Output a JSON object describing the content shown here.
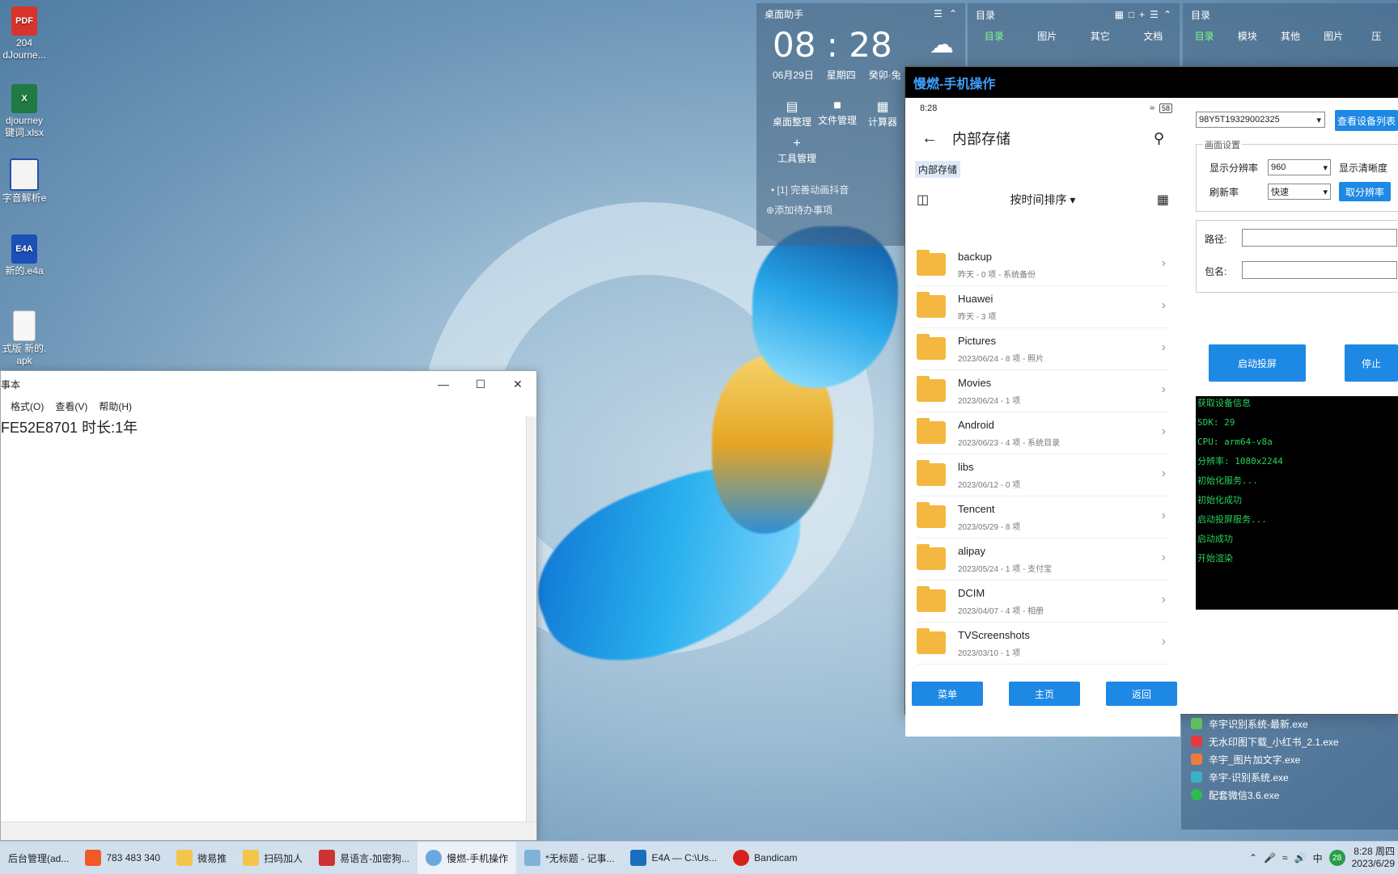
{
  "desktop": {
    "icons": [
      {
        "badge": "PDF",
        "line1": "204",
        "line2": "dJourne..."
      },
      {
        "badge": "X",
        "line1": "djourney",
        "line2": "键词.xlsx"
      },
      {
        "badge": "",
        "line1": "字音解析e",
        "line2": ""
      },
      {
        "badge": "E4A",
        "line1": "新的.e4a",
        "line2": ""
      },
      {
        "badge": "",
        "line1": "式版 新的.",
        "line2": "apk"
      }
    ]
  },
  "notepad": {
    "title": "事本",
    "menu": [
      "格式(O)",
      "查看(V)",
      "帮助(H)"
    ],
    "content": "FE52E8701  时长:1年"
  },
  "widget": {
    "title": "桌面助手",
    "time": "08 : 28",
    "date": "06月29日",
    "weekday": "星期四",
    "lunar": "癸卯·兔",
    "tools": [
      "桌面整理",
      "文件管理",
      "计算器"
    ],
    "tool_manage": "工具管理",
    "todo": "[1] 完善动画抖音",
    "add_todo": "添加待办事项"
  },
  "catalog1": {
    "title": "目录",
    "tabs": [
      "目录",
      "图片",
      "其它",
      "文档"
    ]
  },
  "catalog2": {
    "title": "目录",
    "tabs": [
      "目录",
      "模块",
      "其他",
      "图片",
      "压"
    ]
  },
  "phone_app": {
    "title": "慢燃-手机操作",
    "status_time": "8:28",
    "battery": "58",
    "header": "内部存储",
    "breadcrumb": "内部存储",
    "sort": "按时间排序",
    "folders": [
      {
        "name": "backup",
        "meta": "昨天 - 0 项 - 系统备份"
      },
      {
        "name": "Huawei",
        "meta": "昨天 - 3 项"
      },
      {
        "name": "Pictures",
        "meta": "2023/06/24 - 8 项 - 照片"
      },
      {
        "name": "Movies",
        "meta": "2023/06/24 - 1 项"
      },
      {
        "name": "Android",
        "meta": "2023/06/23 - 4 项 - 系统目录"
      },
      {
        "name": "libs",
        "meta": "2023/06/12 - 0 项"
      },
      {
        "name": "Tencent",
        "meta": "2023/05/29 - 8 项"
      },
      {
        "name": "alipay",
        "meta": "2023/05/24 - 1 项 - 支付宝"
      },
      {
        "name": "DCIM",
        "meta": "2023/04/07 - 4 项 - 相册"
      },
      {
        "name": "TVScreenshots",
        "meta": "2023/03/10 - 1 项"
      }
    ],
    "bottom_buttons": [
      "菜单",
      "主页",
      "返回"
    ],
    "device_id": "98Y5T19329002325",
    "view_devices": "查看设备列表",
    "group_label": "画面设置",
    "resolution_label": "显示分辨率",
    "resolution_value": "960",
    "clarity_label": "显示清晰度",
    "refresh_label": "刷新率",
    "refresh_value": "快速",
    "cancel_res": "取分辨率",
    "path_label": "路径:",
    "pkg_label": "包名:",
    "start_cast": "启动投屏",
    "stop": "停止",
    "log": [
      "获取设备信息",
      "SDK: 29",
      "CPU: arm64-v8a",
      "分辨率: 1080x2244",
      "初始化服务...",
      "初始化成功",
      "启动投屏服务...",
      "启动成功",
      "开始渲染"
    ]
  },
  "desktop_files": [
    "辛宇识别系统-最新.exe",
    "无水印图下载_小红书_2.1.exe",
    "辛宇_图片加文字.exe",
    "辛宇-识别系统.exe",
    "配套微信3.6.exe"
  ],
  "taskbar": {
    "items": [
      "后台管理(ad...",
      "783 483 340",
      "微易推",
      "扫码加人",
      "易语言-加密狗...",
      "慢燃-手机操作",
      "*无标题 - 记事...",
      "E4A — C:\\Us...",
      "Bandicam"
    ],
    "tray_lang": "中",
    "temp": "28",
    "time": "8:28 周四",
    "date": "2023/6/29"
  }
}
